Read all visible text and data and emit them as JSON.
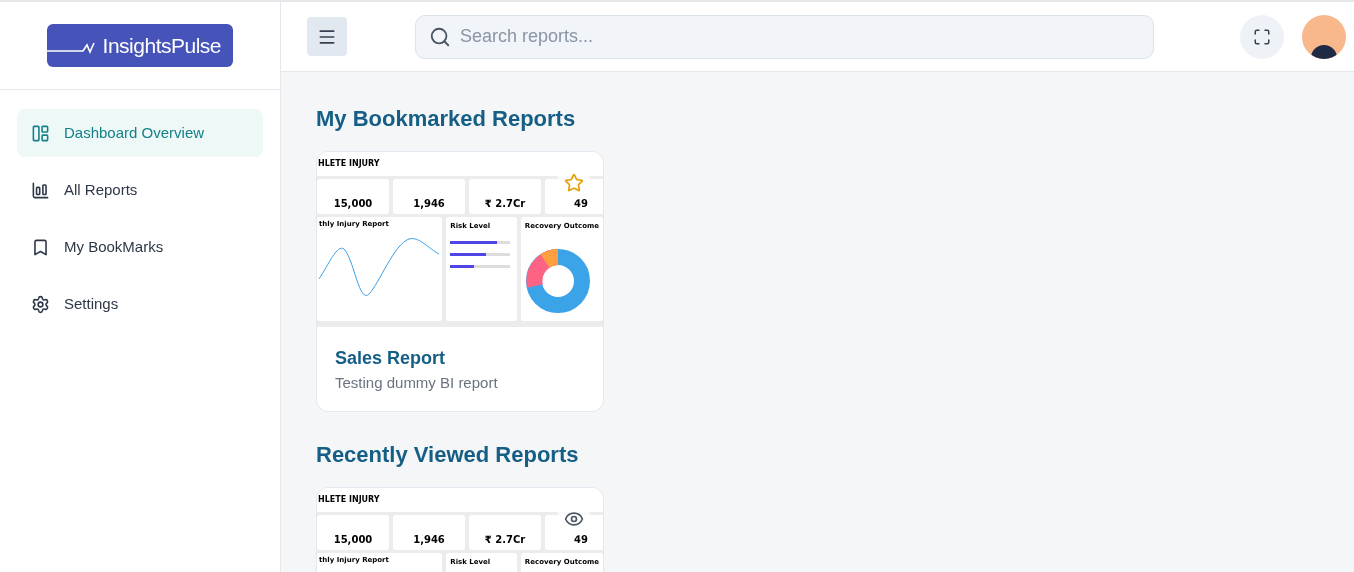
{
  "logo": {
    "text": "InsightsPulse"
  },
  "sidebar": {
    "items": [
      {
        "label": "Dashboard Overview",
        "selected": true
      },
      {
        "label": "All Reports",
        "selected": false
      },
      {
        "label": "My BookMarks",
        "selected": false
      },
      {
        "label": "Settings",
        "selected": false
      }
    ]
  },
  "header": {
    "search": {
      "placeholder": "Search reports..."
    }
  },
  "sections": [
    {
      "title": "My Bookmarked Reports",
      "cards": [
        {
          "thumbnail": {
            "title": "HLETE INJURY",
            "kpis": [
              "15,000",
              "1,946",
              "₹ 2.7Cr",
              "49"
            ],
            "panels": [
              "thly Injury Report",
              "Risk Level",
              "Recovery Outcome"
            ],
            "risk_bars": [
              {
                "level": 0.78
              },
              {
                "level": 0.6
              },
              {
                "level": 0.4
              }
            ]
          },
          "name": "Sales Report",
          "description": "Testing dummy BI report"
        }
      ]
    },
    {
      "title": "Recently Viewed Reports",
      "cards": [
        {
          "thumbnail": {
            "title": "HLETE INJURY",
            "kpis": [
              "15,000",
              "1,946",
              "₹ 2.7Cr",
              "49"
            ],
            "panels": [
              "thly Injury Report",
              "Risk Level",
              "Recovery Outcome"
            ]
          }
        }
      ]
    }
  ]
}
